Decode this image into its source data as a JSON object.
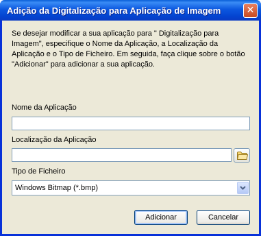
{
  "window": {
    "title": "Adição da Digitalização para Aplicação de Imagem",
    "close_label": "✕"
  },
  "intro": "Se desejar modificar a sua aplicação para \" Digitalização para Imagem\", especifique o Nome da Aplicação, a Localização da Aplicação e o Tipo de Ficheiro. Em seguida, faça clique sobre o botão  \"Adicionar\" para adicionar a sua aplicação.",
  "fields": {
    "name_label": "Nome da Aplicação",
    "name_value": "",
    "location_label": "Localização da Aplicação",
    "location_value": "",
    "filetype_label": "Tipo de Ficheiro",
    "filetype_value": "Windows Bitmap (*.bmp)"
  },
  "buttons": {
    "add": "Adicionar",
    "cancel": "Cancelar"
  },
  "icons": {
    "browse": "folder-icon",
    "dropdown": "chevron-down-icon",
    "close": "close-icon"
  },
  "colors": {
    "titlebar": "#0343d0",
    "dialog_bg": "#ece9d8",
    "close_button": "#c74a22"
  }
}
